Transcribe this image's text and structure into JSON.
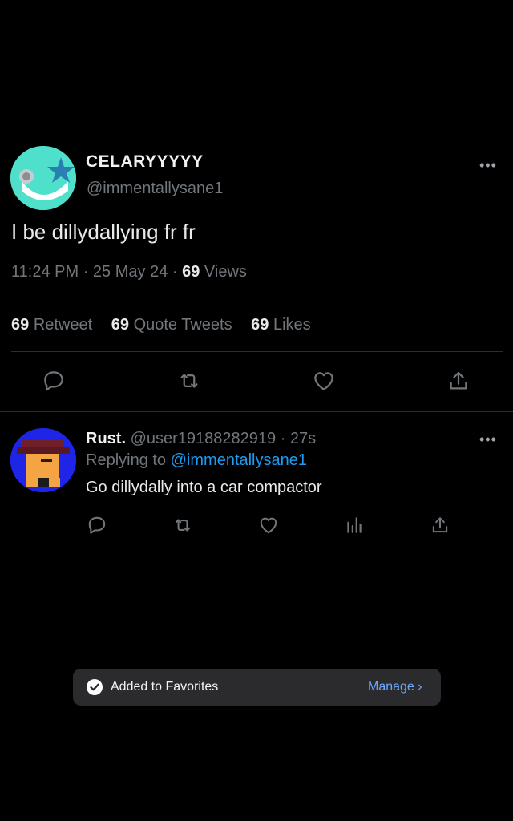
{
  "main_tweet": {
    "author_name": "CELARYYYYY",
    "author_handle": "@immentallysane1",
    "text": "I be dillydallying fr fr",
    "time": "11:24 PM",
    "date": "25 May 24",
    "views_count": "69",
    "views_label": "Views",
    "separator": "·",
    "stats": [
      {
        "count": "69",
        "label": "Retweet"
      },
      {
        "count": "69",
        "label": "Quote Tweets"
      },
      {
        "count": "69",
        "label": "Likes"
      }
    ],
    "actions": [
      "reply-icon",
      "retweet-icon",
      "like-icon",
      "share-icon"
    ],
    "more": "•••"
  },
  "reply": {
    "author_name": "Rust.",
    "author_handle": "@user19188282919",
    "time": "27s",
    "separator": "·",
    "replying_to_label": "Replying to",
    "replying_to_handle": "@immentallysane1",
    "text": "Go dillydally into a car compactor",
    "actions": [
      "reply-icon",
      "retweet-icon",
      "like-icon",
      "analytics-icon",
      "share-icon"
    ],
    "more": "•••"
  },
  "toast": {
    "message": "Added to Favorites",
    "action_label": "Manage",
    "action_chevron": "›"
  },
  "colors": {
    "background": "#000000",
    "accent": "#1d9bf0",
    "muted": "#71767b",
    "toast_bg": "#2b2b2e",
    "toast_action": "#6aa9ff"
  }
}
